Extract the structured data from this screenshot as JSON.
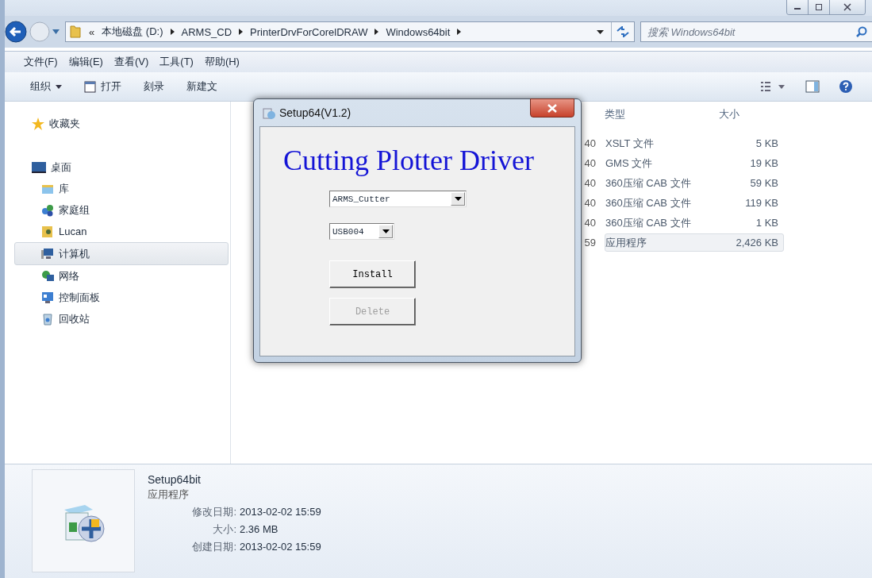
{
  "address": {
    "overflow": "«",
    "crumbs": [
      "本地磁盘 (D:)",
      "ARMS_CD",
      "PrinterDrvForCorelDRAW",
      "Windows64bit"
    ]
  },
  "search": {
    "placeholder": "搜索 Windows64bit"
  },
  "menu": [
    "文件(F)",
    "编辑(E)",
    "查看(V)",
    "工具(T)",
    "帮助(H)"
  ],
  "toolbar": [
    {
      "label": "组织",
      "kind": "menu"
    },
    {
      "label": "打开",
      "kind": "open"
    },
    {
      "label": "刻录",
      "kind": "plain"
    },
    {
      "label": "新建文",
      "kind": "plain"
    }
  ],
  "sidebar": {
    "favorites": "收藏夹",
    "root": {
      "label": "桌面",
      "children": [
        {
          "label": "库",
          "selected": false
        },
        {
          "label": "家庭组",
          "selected": false
        },
        {
          "label": "Lucan",
          "selected": false
        },
        {
          "label": "计算机",
          "selected": true
        },
        {
          "label": "网络",
          "selected": false
        },
        {
          "label": "控制面板",
          "selected": false
        },
        {
          "label": "回收站",
          "selected": false
        }
      ]
    }
  },
  "file_list": {
    "columns": [
      "类型",
      "大小"
    ],
    "rows": [
      {
        "date_tail": "40",
        "type": "XSLT 文件",
        "size": "5 KB",
        "selected": false
      },
      {
        "date_tail": "40",
        "type": "GMS 文件",
        "size": "19 KB",
        "selected": false
      },
      {
        "date_tail": "40",
        "type": "360压缩 CAB 文件",
        "size": "59 KB",
        "selected": false
      },
      {
        "date_tail": "40",
        "type": "360压缩 CAB 文件",
        "size": "119 KB",
        "selected": false
      },
      {
        "date_tail": "40",
        "type": "360压缩 CAB 文件",
        "size": "1 KB",
        "selected": false
      },
      {
        "date_tail": "59",
        "type": "应用程序",
        "size": "2,426 KB",
        "selected": true
      }
    ]
  },
  "dialog": {
    "title": "Setup64(V1.2)",
    "heading": "Cutting Plotter Driver",
    "model": "ARMS_Cutter",
    "port": "USB004",
    "buttons": [
      {
        "label": "Install",
        "disabled": false
      },
      {
        "label": "Delete",
        "disabled": true
      }
    ]
  },
  "details": {
    "name": "Setup64bit",
    "type": "应用程序",
    "fields": [
      {
        "label": "修改日期:",
        "value": "2013-02-02 15:59"
      },
      {
        "label": "大小:",
        "value": "2.36 MB"
      },
      {
        "label": "创建日期:",
        "value": "2013-02-02 15:59"
      }
    ]
  }
}
